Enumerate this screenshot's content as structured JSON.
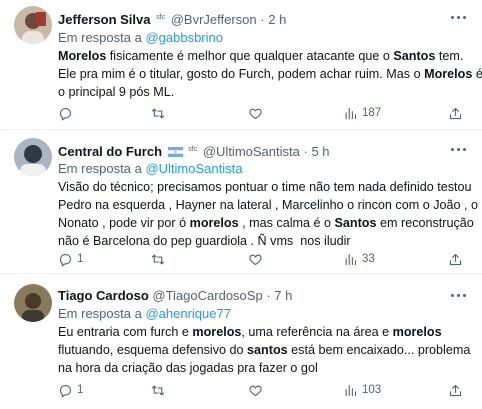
{
  "tweets": [
    {
      "name": "Jefferson Silva",
      "badge": "sfc",
      "handle": "@BvrJefferson",
      "dot": "·",
      "time": "2 h",
      "reply_prefix": "Em resposta a",
      "reply_to": "@gabbsbrino",
      "lines": [
        [
          {
            "t": "Morelos",
            "b": true
          },
          {
            "t": " fisicamente é melhor que qualquer atacante que o "
          },
          {
            "t": "Santos",
            "b": true
          },
          {
            "t": " tem."
          }
        ],
        [
          {
            "t": "Ele pra mim é o titular, gosto do Furch, podem achar ruim. Mas o "
          },
          {
            "t": "Morelos",
            "b": true
          },
          {
            "t": " é"
          }
        ],
        [
          {
            "t": "o principal 9 pós ML."
          }
        ]
      ],
      "views": "187",
      "replies": "",
      "retweets": "",
      "likes": ""
    },
    {
      "name": "Central do Furch",
      "badge": "sfc",
      "handle": "@UltimoSantista",
      "dot": "·",
      "time": "5 h",
      "reply_prefix": "Em resposta a",
      "reply_to": "@UltimoSantista",
      "lines": [
        [
          {
            "t": "Visão do técnico; precisamos pontuar o time não tem nada definido testou"
          }
        ],
        [
          {
            "t": "Pedro na esquerda , Hayner na lateral , Marcelinho o rincon com o João , o"
          }
        ],
        [
          {
            "t": "Nonato , pode vir por ó "
          },
          {
            "t": "morelos",
            "b": true
          },
          {
            "t": " , mas calma é o "
          },
          {
            "t": "Santos",
            "b": true
          },
          {
            "t": " em reconstrução"
          }
        ],
        [
          {
            "t": "não é Barcelona do pep guardiola . Ñ vms  nos iludir"
          }
        ]
      ],
      "replies": "1",
      "retweets": "",
      "likes": "",
      "views": "33"
    },
    {
      "name": "Tiago Cardoso",
      "badge": "",
      "handle": "@TiagoCardosoSp",
      "dot": "·",
      "time": "7 h",
      "reply_prefix": "Em resposta a",
      "reply_to": "@ahenrique77",
      "lines": [
        [
          {
            "t": "Eu entraria com furch e "
          },
          {
            "t": "morelos",
            "b": true
          },
          {
            "t": ", uma referência na área e "
          },
          {
            "t": "morelos",
            "b": true
          }
        ],
        [
          {
            "t": "flutuando, esquema defensivo do "
          },
          {
            "t": "santos",
            "b": true
          },
          {
            "t": " está bem encaixado... problema"
          }
        ],
        [
          {
            "t": "na hora da criação das jogadas pra fazer o gol"
          }
        ]
      ],
      "replies": "1",
      "retweets": "",
      "likes": "",
      "views": "103"
    }
  ],
  "colors": {
    "text": "#0f1419",
    "muted": "#536471",
    "link": "#1d9bf0",
    "divider": "#eff3f4"
  },
  "icons": [
    "more-icon",
    "reply-icon",
    "retweet-icon",
    "like-icon",
    "views-icon",
    "share-icon",
    "argentina-flag-icon"
  ]
}
